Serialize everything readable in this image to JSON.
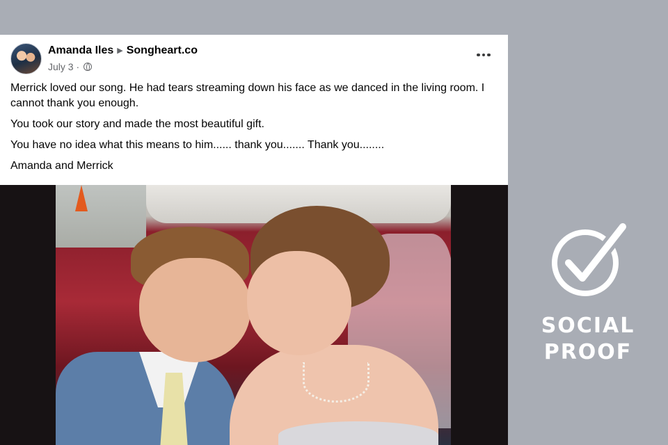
{
  "post": {
    "author": "Amanda Iles",
    "page": "Songheart.co",
    "date": "July 3",
    "separator": "·",
    "audience_icon": "globe-icon",
    "more_icon": "more-dots-icon",
    "paragraphs": [
      "Merrick loved our song. He had tears streaming down his face as we danced in the living room. I cannot thank you enough.",
      "You took our story and made the most beautiful gift.",
      "You have no idea what this means to him...... thank you....... Thank you........",
      "Amanda and Merrick"
    ],
    "photo_alt": "wedding-couple-photo"
  },
  "badge": {
    "icon": "check-circle-icon",
    "text": "SOCIAL\nPROOF"
  },
  "colors": {
    "background": "#a9adb5",
    "card": "#ffffff",
    "photo_frame": "#171214",
    "badge_text": "#ffffff"
  }
}
